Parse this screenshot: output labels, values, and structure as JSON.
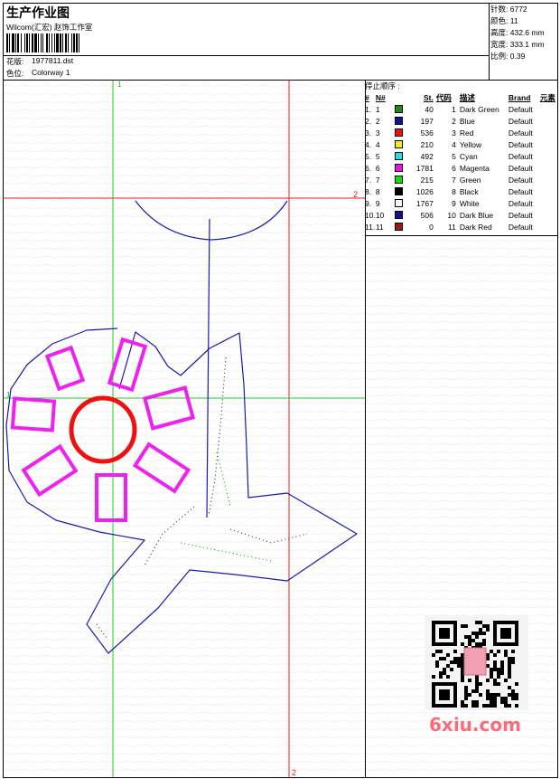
{
  "header": {
    "title": "生产作业图",
    "company": "Wilcom(汇宏) 赵饰工作室",
    "design_label": "花版:",
    "design_file": "1977811.dst",
    "colorway_label": "色位:",
    "colorway": "Colorway 1"
  },
  "stats": [
    {
      "label": "针数:",
      "value": "6772"
    },
    {
      "label": "颜色:",
      "value": "11"
    },
    {
      "label": "高度:",
      "value": "432.6 mm"
    },
    {
      "label": "宽度:",
      "value": "333.1 mm"
    },
    {
      "label": "比例:",
      "value": "0.39"
    }
  ],
  "stop_sequence": {
    "title": "停止顺序 :",
    "columns": [
      "#",
      "N#",
      "St.",
      "代码",
      "描述",
      "Brand",
      "元素"
    ],
    "rows": [
      {
        "idx": "1.",
        "n": "1",
        "color": "#1a8c1a",
        "st": "40",
        "code": "1",
        "desc": "Dark Green",
        "brand": "Default"
      },
      {
        "idx": "2.",
        "n": "2",
        "color": "#10109a",
        "st": "197",
        "code": "2",
        "desc": "Blue",
        "brand": "Default"
      },
      {
        "idx": "3.",
        "n": "3",
        "color": "#ee1111",
        "st": "536",
        "code": "3",
        "desc": "Red",
        "brand": "Default"
      },
      {
        "idx": "4.",
        "n": "4",
        "color": "#f2f200",
        "st": "210",
        "code": "4",
        "desc": "Yellow",
        "brand": "Default"
      },
      {
        "idx": "5.",
        "n": "5",
        "color": "#22e0e0",
        "st": "492",
        "code": "5",
        "desc": "Cyan",
        "brand": "Default"
      },
      {
        "idx": "6.",
        "n": "6",
        "color": "#ee11ee",
        "st": "1781",
        "code": "6",
        "desc": "Magenta",
        "brand": "Default"
      },
      {
        "idx": "7.",
        "n": "7",
        "color": "#11dd11",
        "st": "215",
        "code": "7",
        "desc": "Green",
        "brand": "Default"
      },
      {
        "idx": "8.",
        "n": "8",
        "color": "#000000",
        "st": "1026",
        "code": "8",
        "desc": "Black",
        "brand": "Default"
      },
      {
        "idx": "9.",
        "n": "9",
        "color": "#f4f4f4",
        "st": "1767",
        "code": "9",
        "desc": "White",
        "brand": "Default"
      },
      {
        "idx": "10.",
        "n": "10",
        "color": "#11118a",
        "st": "506",
        "code": "10",
        "desc": "Dark Blue",
        "brand": "Default"
      },
      {
        "idx": "11.",
        "n": "11",
        "color": "#9a1a1a",
        "st": "0",
        "code": "11",
        "desc": "Dark Red",
        "brand": "Default"
      }
    ]
  },
  "guides": {
    "v1": "1",
    "h1": "1",
    "h2": "2",
    "v2": "2"
  },
  "watermark": "6xiu.com",
  "colors": {
    "guide_green": "#22cc22",
    "guide_red": "#dd2222",
    "outline_blue": "#1a1aa8",
    "flower_magenta": "#ee22ee",
    "ring_red": "#ee1111"
  }
}
